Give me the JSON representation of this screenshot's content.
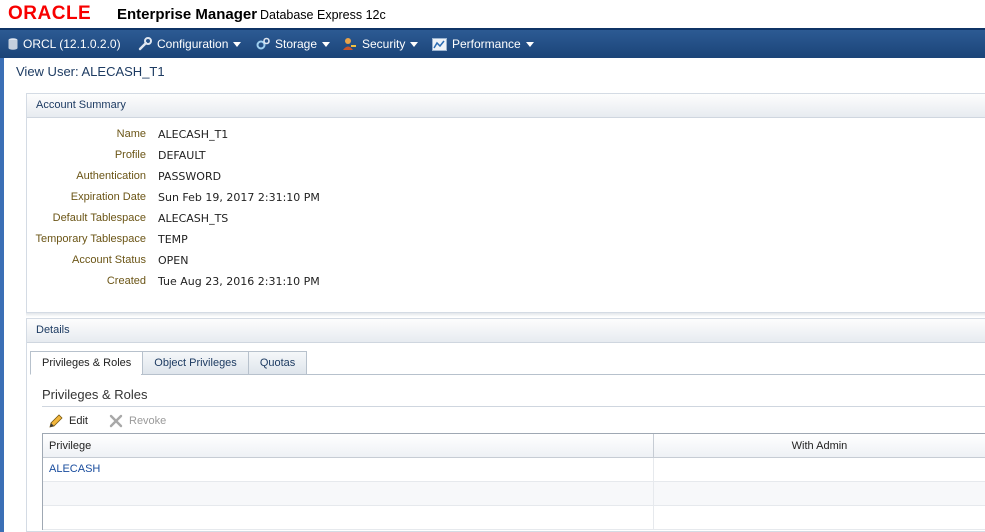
{
  "header": {
    "logo_text": "ORACLE",
    "product_name": "Enterprise Manager",
    "product_sub": "Database Express 12c"
  },
  "nav": {
    "database": "ORCL (12.1.0.2.0)",
    "items": [
      {
        "label": "Configuration",
        "icon": "wrench-icon"
      },
      {
        "label": "Storage",
        "icon": "gears-icon"
      },
      {
        "label": "Security",
        "icon": "user-key-icon"
      },
      {
        "label": "Performance",
        "icon": "chart-icon"
      }
    ]
  },
  "page": {
    "title": "View User: ALECASH_T1"
  },
  "account_summary": {
    "heading": "Account Summary",
    "fields": [
      {
        "label": "Name",
        "value": "ALECASH_T1"
      },
      {
        "label": "Profile",
        "value": "DEFAULT"
      },
      {
        "label": "Authentication",
        "value": "PASSWORD"
      },
      {
        "label": "Expiration Date",
        "value": "Sun Feb 19, 2017 2:31:10 PM"
      },
      {
        "label": "Default Tablespace",
        "value": "ALECASH_TS"
      },
      {
        "label": "Temporary Tablespace",
        "value": "TEMP"
      },
      {
        "label": "Account Status",
        "value": "OPEN"
      },
      {
        "label": "Created",
        "value": "Tue Aug 23, 2016 2:31:10 PM"
      }
    ]
  },
  "details": {
    "heading": "Details",
    "tabs": [
      "Privileges & Roles",
      "Object Privileges",
      "Quotas"
    ],
    "active_tab": "Privileges & Roles",
    "section_title": "Privileges & Roles",
    "toolbar": {
      "edit": "Edit",
      "revoke": "Revoke"
    },
    "table": {
      "columns": [
        "Privilege",
        "With Admin"
      ],
      "rows": [
        {
          "privilege": "ALECASH",
          "with_admin": ""
        }
      ]
    }
  },
  "colors": {
    "brand_red": "#f80000",
    "nav_blue": "#1b4478",
    "label_brown": "#6b5516",
    "link_blue": "#1a4d9e"
  }
}
